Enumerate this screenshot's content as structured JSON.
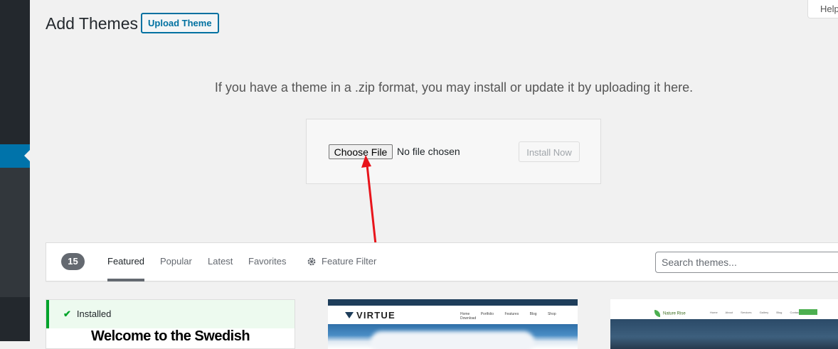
{
  "header": {
    "title": "Add Themes",
    "upload_theme_label": "Upload Theme",
    "help_label": "Help"
  },
  "upload": {
    "description": "If you have a theme in a .zip format, you may install or update it by uploading it here.",
    "choose_file_label": "Choose File",
    "no_file_text": "No file chosen",
    "install_now_label": "Install Now"
  },
  "filter_bar": {
    "count": "15",
    "tabs": [
      {
        "label": "Featured",
        "current": true
      },
      {
        "label": "Popular",
        "current": false
      },
      {
        "label": "Latest",
        "current": false
      },
      {
        "label": "Favorites",
        "current": false
      }
    ],
    "feature_filter_label": "Feature Filter",
    "search_placeholder": "Search themes..."
  },
  "themes": [
    {
      "installed_label": "Installed",
      "preview_heading": "Welcome to the Swedish"
    },
    {
      "logo_text": "VIRTUE",
      "menu_text": "Home Portfolio Features Blog Shop Download"
    },
    {
      "logo_text": "Nature Rise",
      "menu_text": "Home About Services Gallery Blog Contact"
    }
  ],
  "colors": {
    "accent": "#0071a1",
    "annotation_arrow": "#e8141b",
    "installed_green": "#00a32a"
  },
  "icons": {
    "installed": "check-icon",
    "feature_filter": "gear-icon"
  }
}
